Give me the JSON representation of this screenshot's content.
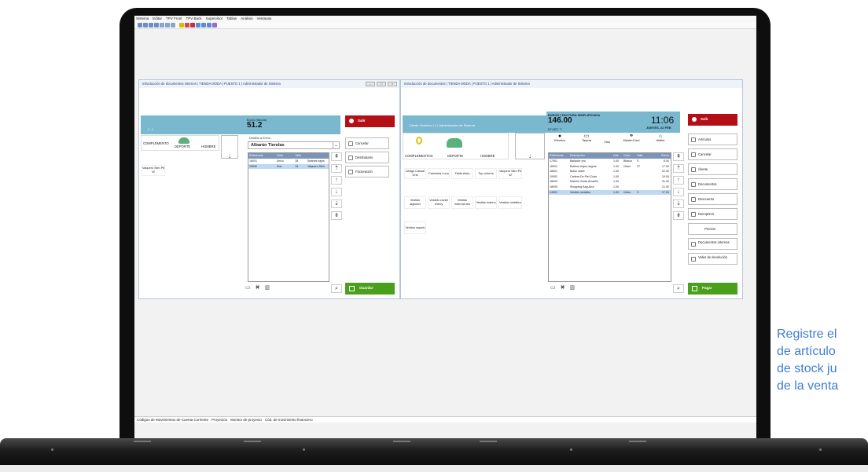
{
  "menu": [
    "Sistema",
    "Editar",
    "TPV Front",
    "TPV Back",
    "Supervisor",
    "Tablas",
    "Análisis",
    "Ventanas"
  ],
  "taskbar": [
    "Códigos de Movimientos de Cuenta Corriente",
    "Proyectos",
    "Monitor de proyecto",
    "Cód. de movimiento financiero"
  ],
  "left_window": {
    "title": "Introducción de documentos internos | TIENDA MODA | PUESTO 1 | Administrador de Sistema",
    "header_small": "Euros (tienda)",
    "total": "51.2",
    "header_sub": "-1 -1",
    "categories": [
      "COMPLEMENTO",
      "DEPORTE",
      "HOMBRE"
    ],
    "destino_label": "Destino a Envío",
    "destino_value": "Albarán Tiendas",
    "columns": [
      "Referencia",
      "Color",
      "Talla",
      ""
    ],
    "rows": [
      [
        "16001",
        "Único",
        "38",
        "Botines bajos"
      ],
      [
        "15000",
        "Gris",
        "34",
        "Vaquero Slim"
      ]
    ],
    "product": "Vaquero Slim Pit W",
    "btn_salir": "Salir",
    "btn_cancelar": "Cancelar",
    "btn_destinatario": "Destinatario",
    "btn_facturacion": "Facturación",
    "btn_guardar": "Guardar"
  },
  "right_window": {
    "title": "Introducción de documentos | TIENDA MODA | PUESTO 1 | Administrador de Sistema",
    "client": "Cliente Genérico | 1 | Administrador de Sistema",
    "doc_type": "EUROS | FACTURA SIMPLIFICADA",
    "total": "146.00",
    "doc_num": "Nº ART. 7",
    "time": "11:06",
    "date": "JUEVES, 22 FEB",
    "categories": [
      "COMPLEMENTOS",
      "DEPORTE",
      "HOMBRE"
    ],
    "payments": [
      "Efectivo",
      "Tarjeta",
      "Visa",
      "MasterCard",
      "Wallet"
    ],
    "products": [
      "Abrigo Casual Gris",
      "Camiseta Luna",
      "Falda Asey",
      "Top colores",
      "Vaquero Slim Pit W",
      "Vestido algodón",
      "Vestido cóctel cherry",
      "Vestido informal tea",
      "Vestido marino",
      "Vestido metálico",
      "Vestido rayado"
    ],
    "columns": [
      "Referencia",
      "Descripción",
      "Uds",
      "Color",
      "Talla",
      "Precio"
    ],
    "rows": [
      [
        "17001",
        "Bañador pro",
        "1.00",
        "Blanco",
        "S",
        "8.00"
      ],
      [
        "16001",
        "Botines bajos negros",
        "1.00",
        "Único",
        "37",
        "17.00"
      ],
      [
        "18001",
        "Bolso casel",
        "1.00",
        "",
        "",
        "22.00"
      ],
      [
        "10002",
        "Cartera De Piel Cube",
        "1.00",
        "",
        "",
        "19.00"
      ],
      [
        "18004",
        "Maletín Verde Amarillo",
        "1.00",
        "",
        "",
        "31.00"
      ],
      [
        "18009",
        "Shopping Bag Azul",
        "1.00",
        "",
        "",
        "21.00"
      ],
      [
        "14001",
        "Vestido metalico",
        "1.00",
        "Único",
        "S",
        "27.00"
      ]
    ],
    "btn_salir": "Salir",
    "side_buttons": [
      "Artículos",
      "Cancelar",
      "cliente",
      "Documentos",
      "Descuento",
      "Reimprimir",
      "Precios",
      "Documentos internos",
      "Vales de devolución"
    ],
    "btn_pagar": "Pagar"
  },
  "promo_text": "Registre el\nde artículo\nde stock ju\nde la venta",
  "colors": {
    "header_blue": "#79b8cf",
    "save_green": "#4aa01c",
    "exit_red": "#b40f16",
    "promo_blue": "#3f7ed0"
  }
}
